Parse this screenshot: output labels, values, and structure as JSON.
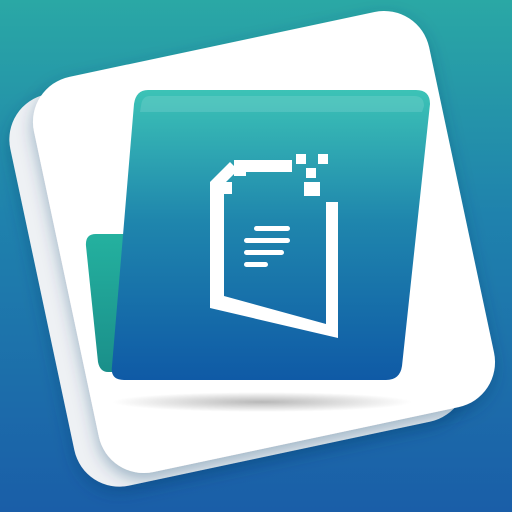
{
  "app_icon": {
    "icon": "document-folder-icon",
    "colors": {
      "background_top": "#2aa8a5",
      "background_bottom": "#1a5ea8",
      "card": "#ffffff",
      "folder_front_top": "#3cc3b6",
      "folder_front_bottom": "#0f5aa6",
      "folder_back": "#20a094",
      "document_glyph": "#ffffff"
    }
  }
}
